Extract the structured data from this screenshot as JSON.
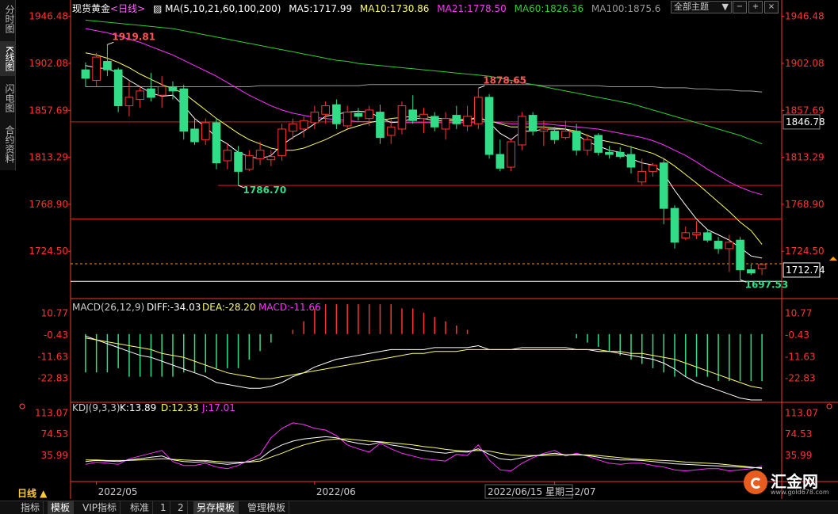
{
  "left_tabs": [
    {
      "label": "分时图",
      "active": false
    },
    {
      "label": "K线图",
      "active": true
    },
    {
      "label": "闪电图",
      "active": false
    },
    {
      "label": "合约资料",
      "active": false
    }
  ],
  "header": {
    "instrument": "现货黄金",
    "period_link": "<日线>",
    "ma_params": "MA(5,10,21,60,100,200)",
    "ma5": "MA5:1717.99",
    "ma10": "MA10:1730.86",
    "ma21": "MA21:1778.50",
    "ma60": "MA60:1826.36",
    "ma100": "MA100:1875.6",
    "theme_select": "全部主题",
    "theme_arrow": "▼",
    "btn_minus": "−",
    "btn_plus": "+",
    "btn_close": "×"
  },
  "colors": {
    "up": "#ff3333",
    "down": "#33dd88",
    "ma5": "#ffffff",
    "ma10": "#ffff66",
    "ma21": "#ff33ff",
    "ma60": "#33cc33",
    "ma100": "#999999",
    "axis": "#ff3333",
    "grid": "#333333"
  },
  "price_axis": {
    "labels": [
      "1946.48",
      "1902.08",
      "1857.69",
      "1813.29",
      "1768.90",
      "1724.50"
    ],
    "range": [
      1685,
      1956
    ],
    "current_box": "1846.78",
    "current_box_value": 1846.78,
    "last_box": "1712.74",
    "last_value": 1712.74
  },
  "annotations": [
    {
      "text": "1919.81",
      "value": 1919.81
    },
    {
      "text": "1878.65",
      "value": 1878.65
    },
    {
      "text": "1786.70",
      "value": 1786.7
    },
    {
      "text": "1697.53",
      "value": 1697.53
    }
  ],
  "hlines": [
    1846.78,
    1786.7,
    1755.0,
    1712.74,
    1697.53
  ],
  "macd": {
    "title": "MACD(26,12,9)",
    "diff": "DIFF:-34.03",
    "dea": "DEA:-28.20",
    "macd": "MACD:-11.66",
    "labels": [
      "10.77",
      "-0.43",
      "-11.63",
      "-22.83"
    ],
    "range": [
      -34,
      13
    ]
  },
  "kdj": {
    "title": "KDJ(9,3,3)",
    "k": "K:13.89",
    "d": "D:12.33",
    "j": "J:17.01",
    "labels": [
      "113.07",
      "74.53",
      "35.99"
    ],
    "range": [
      -4,
      125
    ]
  },
  "date_axis": {
    "labels": [
      "2022/05",
      "2022/06",
      "2022/07"
    ],
    "cursor_label": "2022/06/15 星期三"
  },
  "period_label": "日线 ▲",
  "bottom_tabs": [
    {
      "label": "指标",
      "active": false
    },
    {
      "label": "模板",
      "active": true
    },
    {
      "label": "VIP指标",
      "active": false
    },
    {
      "label": "标准",
      "active": false
    },
    {
      "label": "1",
      "active": false
    },
    {
      "label": "2",
      "active": false
    },
    {
      "label": "另存模板",
      "active": true
    },
    {
      "label": "管理模板",
      "active": false
    }
  ],
  "logo": {
    "name": "汇金网",
    "url": "www.gold678.com"
  },
  "chart_data": {
    "type": "candlestick",
    "candles": [
      {
        "o": 1896,
        "h": 1903,
        "l": 1880,
        "c": 1888
      },
      {
        "o": 1886,
        "h": 1912,
        "l": 1880,
        "c": 1908
      },
      {
        "o": 1904,
        "h": 1920,
        "l": 1890,
        "c": 1896
      },
      {
        "o": 1896,
        "h": 1898,
        "l": 1856,
        "c": 1862
      },
      {
        "o": 1862,
        "h": 1885,
        "l": 1852,
        "c": 1870
      },
      {
        "o": 1868,
        "h": 1880,
        "l": 1860,
        "c": 1876
      },
      {
        "o": 1878,
        "h": 1893,
        "l": 1866,
        "c": 1870
      },
      {
        "o": 1872,
        "h": 1890,
        "l": 1860,
        "c": 1880
      },
      {
        "o": 1880,
        "h": 1885,
        "l": 1868,
        "c": 1876
      },
      {
        "o": 1878,
        "h": 1882,
        "l": 1830,
        "c": 1838
      },
      {
        "o": 1840,
        "h": 1850,
        "l": 1825,
        "c": 1828
      },
      {
        "o": 1830,
        "h": 1850,
        "l": 1825,
        "c": 1846
      },
      {
        "o": 1846,
        "h": 1850,
        "l": 1802,
        "c": 1808
      },
      {
        "o": 1810,
        "h": 1826,
        "l": 1802,
        "c": 1820
      },
      {
        "o": 1818,
        "h": 1824,
        "l": 1787,
        "c": 1800
      },
      {
        "o": 1802,
        "h": 1820,
        "l": 1800,
        "c": 1815
      },
      {
        "o": 1812,
        "h": 1828,
        "l": 1806,
        "c": 1820
      },
      {
        "o": 1811,
        "h": 1820,
        "l": 1805,
        "c": 1814
      },
      {
        "o": 1815,
        "h": 1845,
        "l": 1810,
        "c": 1840
      },
      {
        "o": 1838,
        "h": 1850,
        "l": 1830,
        "c": 1845
      },
      {
        "o": 1840,
        "h": 1852,
        "l": 1832,
        "c": 1848
      },
      {
        "o": 1846,
        "h": 1862,
        "l": 1840,
        "c": 1856
      },
      {
        "o": 1854,
        "h": 1866,
        "l": 1845,
        "c": 1862
      },
      {
        "o": 1863,
        "h": 1868,
        "l": 1840,
        "c": 1845
      },
      {
        "o": 1843,
        "h": 1862,
        "l": 1840,
        "c": 1856
      },
      {
        "o": 1855,
        "h": 1860,
        "l": 1848,
        "c": 1852
      },
      {
        "o": 1850,
        "h": 1862,
        "l": 1843,
        "c": 1858
      },
      {
        "o": 1856,
        "h": 1863,
        "l": 1826,
        "c": 1832
      },
      {
        "o": 1834,
        "h": 1850,
        "l": 1826,
        "c": 1842
      },
      {
        "o": 1840,
        "h": 1866,
        "l": 1835,
        "c": 1862
      },
      {
        "o": 1858,
        "h": 1872,
        "l": 1845,
        "c": 1848
      },
      {
        "o": 1850,
        "h": 1860,
        "l": 1836,
        "c": 1854
      },
      {
        "o": 1852,
        "h": 1856,
        "l": 1838,
        "c": 1842
      },
      {
        "o": 1840,
        "h": 1856,
        "l": 1830,
        "c": 1850
      },
      {
        "o": 1853,
        "h": 1862,
        "l": 1840,
        "c": 1845
      },
      {
        "o": 1843,
        "h": 1862,
        "l": 1838,
        "c": 1852
      },
      {
        "o": 1845,
        "h": 1878,
        "l": 1840,
        "c": 1870
      },
      {
        "o": 1870,
        "h": 1873,
        "l": 1812,
        "c": 1816
      },
      {
        "o": 1816,
        "h": 1830,
        "l": 1800,
        "c": 1803
      },
      {
        "o": 1804,
        "h": 1830,
        "l": 1800,
        "c": 1828
      },
      {
        "o": 1825,
        "h": 1856,
        "l": 1820,
        "c": 1852
      },
      {
        "o": 1853,
        "h": 1856,
        "l": 1834,
        "c": 1838
      },
      {
        "o": 1838,
        "h": 1848,
        "l": 1824,
        "c": 1840
      },
      {
        "o": 1838,
        "h": 1842,
        "l": 1826,
        "c": 1830
      },
      {
        "o": 1832,
        "h": 1848,
        "l": 1830,
        "c": 1838
      },
      {
        "o": 1838,
        "h": 1845,
        "l": 1815,
        "c": 1820
      },
      {
        "o": 1820,
        "h": 1835,
        "l": 1815,
        "c": 1830
      },
      {
        "o": 1834,
        "h": 1836,
        "l": 1815,
        "c": 1818
      },
      {
        "o": 1818,
        "h": 1824,
        "l": 1812,
        "c": 1816
      },
      {
        "o": 1818,
        "h": 1823,
        "l": 1812,
        "c": 1814
      },
      {
        "o": 1816,
        "h": 1824,
        "l": 1798,
        "c": 1804
      },
      {
        "o": 1790,
        "h": 1812,
        "l": 1787,
        "c": 1800
      },
      {
        "o": 1800,
        "h": 1808,
        "l": 1795,
        "c": 1806
      },
      {
        "o": 1808,
        "h": 1812,
        "l": 1750,
        "c": 1765
      },
      {
        "o": 1765,
        "h": 1768,
        "l": 1727,
        "c": 1733
      },
      {
        "o": 1737,
        "h": 1748,
        "l": 1735,
        "c": 1742
      },
      {
        "o": 1740,
        "h": 1753,
        "l": 1736,
        "c": 1742
      },
      {
        "o": 1742,
        "h": 1745,
        "l": 1733,
        "c": 1735
      },
      {
        "o": 1734,
        "h": 1738,
        "l": 1722,
        "c": 1727
      },
      {
        "o": 1727,
        "h": 1740,
        "l": 1705,
        "c": 1733
      },
      {
        "o": 1735,
        "h": 1738,
        "l": 1698,
        "c": 1707
      },
      {
        "o": 1707,
        "h": 1712,
        "l": 1702,
        "c": 1704
      },
      {
        "o": 1708,
        "h": 1713,
        "l": 1702,
        "c": 1712
      }
    ],
    "ma5": [
      1900,
      1898,
      1897,
      1893,
      1886,
      1880,
      1874,
      1871,
      1872,
      1862,
      1850,
      1842,
      1832,
      1826,
      1818,
      1814,
      1812,
      1815,
      1825,
      1832,
      1838,
      1845,
      1852,
      1854,
      1856,
      1857,
      1856,
      1851,
      1846,
      1847,
      1850,
      1850,
      1848,
      1848,
      1848,
      1848,
      1852,
      1846,
      1836,
      1830,
      1838,
      1838,
      1840,
      1840,
      1840,
      1835,
      1828,
      1824,
      1820,
      1818,
      1812,
      1808,
      1806,
      1798,
      1782,
      1768,
      1755,
      1745,
      1740,
      1735,
      1728,
      1720,
      1718
    ],
    "ma10": [
      1912,
      1910,
      1907,
      1903,
      1898,
      1892,
      1887,
      1882,
      1878,
      1874,
      1866,
      1858,
      1850,
      1843,
      1836,
      1830,
      1826,
      1822,
      1820,
      1820,
      1822,
      1826,
      1830,
      1835,
      1840,
      1843,
      1846,
      1848,
      1850,
      1851,
      1852,
      1852,
      1850,
      1850,
      1849,
      1849,
      1850,
      1848,
      1845,
      1842,
      1842,
      1842,
      1842,
      1841,
      1840,
      1838,
      1834,
      1830,
      1828,
      1826,
      1823,
      1820,
      1817,
      1812,
      1805,
      1797,
      1789,
      1780,
      1771,
      1762,
      1752,
      1744,
      1731
    ],
    "ma21": [
      1935,
      1933,
      1931,
      1928,
      1925,
      1922,
      1918,
      1914,
      1910,
      1905,
      1900,
      1895,
      1890,
      1884,
      1878,
      1872,
      1867,
      1862,
      1858,
      1855,
      1853,
      1851,
      1850,
      1849,
      1848,
      1847,
      1847,
      1847,
      1847,
      1846,
      1846,
      1846,
      1846,
      1846,
      1846,
      1846,
      1847,
      1847,
      1846,
      1845,
      1845,
      1845,
      1845,
      1844,
      1843,
      1842,
      1841,
      1840,
      1838,
      1836,
      1834,
      1832,
      1829,
      1825,
      1820,
      1815,
      1809,
      1802,
      1796,
      1790,
      1785,
      1781,
      1778
    ],
    "ma60": [
      1943,
      1942,
      1941,
      1940,
      1939,
      1938,
      1937,
      1936,
      1935,
      1933,
      1931,
      1929,
      1927,
      1925,
      1923,
      1921,
      1919,
      1917,
      1915,
      1913,
      1911,
      1909,
      1907,
      1905,
      1904,
      1902,
      1901,
      1900,
      1899,
      1898,
      1897,
      1896,
      1895,
      1894,
      1893,
      1892,
      1891,
      1890,
      1888,
      1886,
      1884,
      1882,
      1880,
      1878,
      1876,
      1874,
      1872,
      1870,
      1868,
      1866,
      1864,
      1861,
      1858,
      1855,
      1852,
      1849,
      1846,
      1843,
      1840,
      1837,
      1834,
      1830,
      1826
    ],
    "ma100": [
      1880,
      1880,
      1880,
      1880,
      1880,
      1880,
      1880,
      1880,
      1880,
      1880,
      1880,
      1880,
      1880,
      1880,
      1880,
      1880,
      1881,
      1881,
      1881,
      1881,
      1881,
      1881,
      1881,
      1881,
      1881,
      1881,
      1882,
      1882,
      1882,
      1882,
      1882,
      1882,
      1882,
      1882,
      1882,
      1882,
      1882,
      1882,
      1882,
      1882,
      1882,
      1882,
      1881,
      1881,
      1881,
      1881,
      1881,
      1881,
      1880,
      1880,
      1880,
      1880,
      1880,
      1879,
      1879,
      1879,
      1878,
      1878,
      1877,
      1877,
      1876,
      1876,
      1875
    ],
    "macd_hist": [
      -9,
      -9,
      -9,
      -8,
      -10,
      -10,
      -10,
      -10,
      -10,
      -9,
      -9,
      -9,
      -8,
      -8,
      -8,
      -6,
      -4,
      -2,
      0,
      1,
      3,
      6,
      7,
      7,
      7,
      7,
      7,
      7,
      7,
      6,
      6,
      5,
      4,
      3,
      2,
      1,
      0,
      0,
      0,
      0,
      0,
      0,
      0,
      0,
      0,
      -1,
      -2,
      -3,
      -4,
      -5,
      -6,
      -7,
      -8,
      -9,
      -10,
      -10,
      -10,
      -10,
      -11,
      -11,
      -11,
      -11,
      -11
    ],
    "macd_diff": [
      -1,
      -3,
      -5,
      -7,
      -9,
      -11,
      -12,
      -14,
      -16,
      -18,
      -20,
      -22,
      -25,
      -26,
      -27,
      -28,
      -28,
      -27,
      -25,
      -22,
      -20,
      -17,
      -15,
      -13,
      -12,
      -11,
      -10,
      -9,
      -8,
      -8,
      -8,
      -8,
      -7,
      -7,
      -7,
      -7,
      -6,
      -8,
      -8,
      -8,
      -7,
      -7,
      -7,
      -7,
      -7,
      -8,
      -8,
      -9,
      -9,
      -10,
      -11,
      -12,
      -13,
      -15,
      -18,
      -22,
      -25,
      -27,
      -29,
      -31,
      -33,
      -34,
      -34
    ],
    "macd_dea": [
      -2,
      -3,
      -4,
      -5,
      -6,
      -7,
      -8,
      -10,
      -11,
      -12,
      -14,
      -16,
      -18,
      -20,
      -21,
      -22,
      -23,
      -23,
      -22,
      -21,
      -20,
      -19,
      -18,
      -17,
      -16,
      -15,
      -14,
      -13,
      -12,
      -11,
      -10,
      -10,
      -9,
      -9,
      -9,
      -8,
      -8,
      -8,
      -8,
      -8,
      -8,
      -8,
      -8,
      -8,
      -8,
      -8,
      -8,
      -8,
      -9,
      -9,
      -10,
      -10,
      -11,
      -12,
      -13,
      -15,
      -17,
      -19,
      -21,
      -23,
      -25,
      -27,
      -28
    ],
    "kdj_k": [
      25,
      27,
      26,
      25,
      28,
      30,
      33,
      35,
      28,
      25,
      24,
      25,
      22,
      20,
      22,
      25,
      30,
      45,
      55,
      62,
      66,
      68,
      70,
      68,
      62,
      58,
      55,
      60,
      55,
      52,
      48,
      45,
      42,
      40,
      43,
      42,
      48,
      38,
      30,
      28,
      32,
      35,
      38,
      40,
      37,
      38,
      36,
      33,
      30,
      28,
      28,
      27,
      25,
      23,
      21,
      20,
      19,
      18,
      17,
      16,
      15,
      14,
      13.89
    ],
    "kdj_d": [
      28,
      28,
      27,
      27,
      27,
      28,
      29,
      30,
      29,
      28,
      27,
      27,
      25,
      24,
      24,
      24,
      26,
      33,
      40,
      48,
      55,
      60,
      64,
      66,
      66,
      64,
      62,
      61,
      59,
      57,
      55,
      52,
      50,
      47,
      45,
      44,
      45,
      44,
      40,
      37,
      36,
      36,
      36,
      37,
      37,
      37,
      37,
      36,
      34,
      32,
      30,
      29,
      28,
      27,
      26,
      24,
      23,
      22,
      21,
      19,
      17,
      15,
      12.33
    ],
    "kdj_j": [
      20,
      24,
      22,
      20,
      30,
      35,
      40,
      45,
      25,
      18,
      18,
      22,
      15,
      12,
      18,
      28,
      38,
      68,
      85,
      95,
      92,
      85,
      82,
      72,
      55,
      48,
      42,
      58,
      48,
      40,
      35,
      30,
      28,
      26,
      38,
      36,
      55,
      28,
      10,
      8,
      22,
      32,
      40,
      45,
      35,
      40,
      35,
      28,
      22,
      20,
      22,
      22,
      18,
      15,
      10,
      8,
      10,
      12,
      12,
      8,
      10,
      12,
      17.01
    ]
  }
}
